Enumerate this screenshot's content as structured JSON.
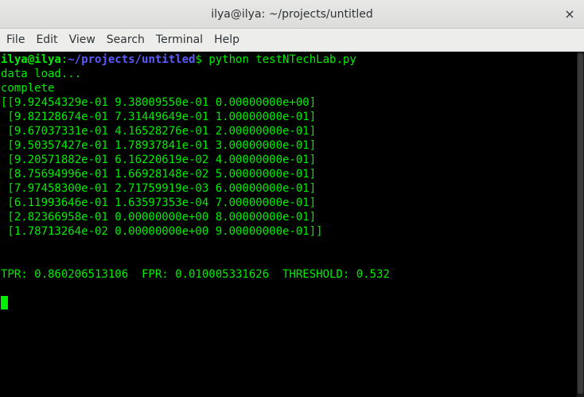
{
  "window": {
    "title": "ilya@ilya: ~/projects/untitled",
    "close_icon": "×"
  },
  "menu": [
    "File",
    "Edit",
    "View",
    "Search",
    "Terminal",
    "Help"
  ],
  "prompt": {
    "user": "ilya@ilya",
    "sep": ":",
    "path": "~/projects/untitled",
    "symbol": "$ ",
    "command": "python testNTechLab.py"
  },
  "output": [
    "data load...",
    "complete",
    "[[9.92454329e-01 9.38009550e-01 0.00000000e+00]",
    " [9.82128674e-01 7.31449649e-01 1.00000000e-01]",
    " [9.67037331e-01 4.16528276e-01 2.00000000e-01]",
    " [9.50357427e-01 1.78937841e-01 3.00000000e-01]",
    " [9.20571882e-01 6.16220619e-02 4.00000000e-01]",
    " [8.75694996e-01 1.66928148e-02 5.00000000e-01]",
    " [7.97458300e-01 2.71759919e-03 6.00000000e-01]",
    " [6.11993646e-01 1.63597353e-04 7.00000000e-01]",
    " [2.82366958e-01 0.00000000e+00 8.00000000e-01]",
    " [1.78713264e-02 0.00000000e+00 9.00000000e-01]]",
    "",
    "",
    "TPR: 0.860206513106  FPR: 0.010005331626  THRESHOLD: 0.532",
    ""
  ],
  "colors": {
    "terminal_fg": "#00ee00",
    "terminal_bg": "#000000",
    "path": "#5c5cff"
  }
}
